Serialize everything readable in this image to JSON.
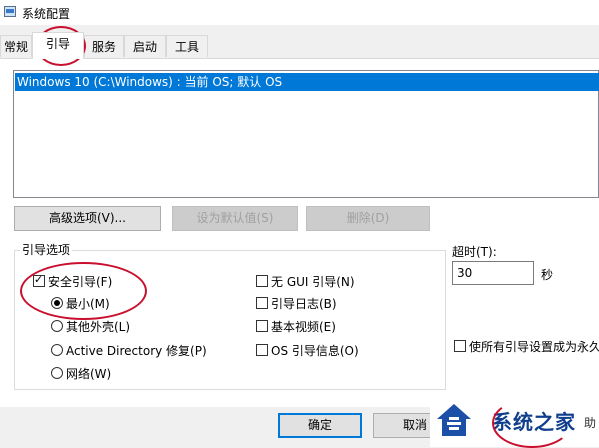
{
  "window": {
    "title": "系统配置"
  },
  "tabs": [
    {
      "label": "常规"
    },
    {
      "label": "引导"
    },
    {
      "label": "服务"
    },
    {
      "label": "启动"
    },
    {
      "label": "工具"
    }
  ],
  "boot_list": {
    "items": [
      {
        "label": "Windows 10 (C:\\Windows) : 当前 OS; 默认 OS",
        "selected": true
      }
    ]
  },
  "buttons": {
    "advanced": "高级选项(V)...",
    "set_default": "设为默认值(S)",
    "delete": "删除(D)",
    "ok": "确定",
    "cancel": "取消"
  },
  "boot_options": {
    "title": "引导选项",
    "safe_boot": {
      "label": "安全引导(F)",
      "checked": true
    },
    "minimal": {
      "label": "最小(M)",
      "selected": true
    },
    "alternate_shell": {
      "label": "其他外壳(L)"
    },
    "active_directory": {
      "label": "Active Directory 修复(P)"
    },
    "network": {
      "label": "网络(W)"
    },
    "no_gui": {
      "label": "无 GUI 引导(N)",
      "checked": false
    },
    "boot_log": {
      "label": "引导日志(B)",
      "checked": false
    },
    "base_video": {
      "label": "基本视频(E)",
      "checked": false
    },
    "os_boot_info": {
      "label": "OS 引导信息(O)",
      "checked": false
    }
  },
  "timeout": {
    "label": "超时(T):",
    "value": "30",
    "unit": "秒"
  },
  "make_permanent": {
    "label": "使所有引导设置成为永久",
    "checked": false
  },
  "watermark": {
    "text": "系统之家",
    "trailing": "助"
  },
  "colors": {
    "highlight": "#0078d7",
    "annotation": "#c8102e"
  }
}
